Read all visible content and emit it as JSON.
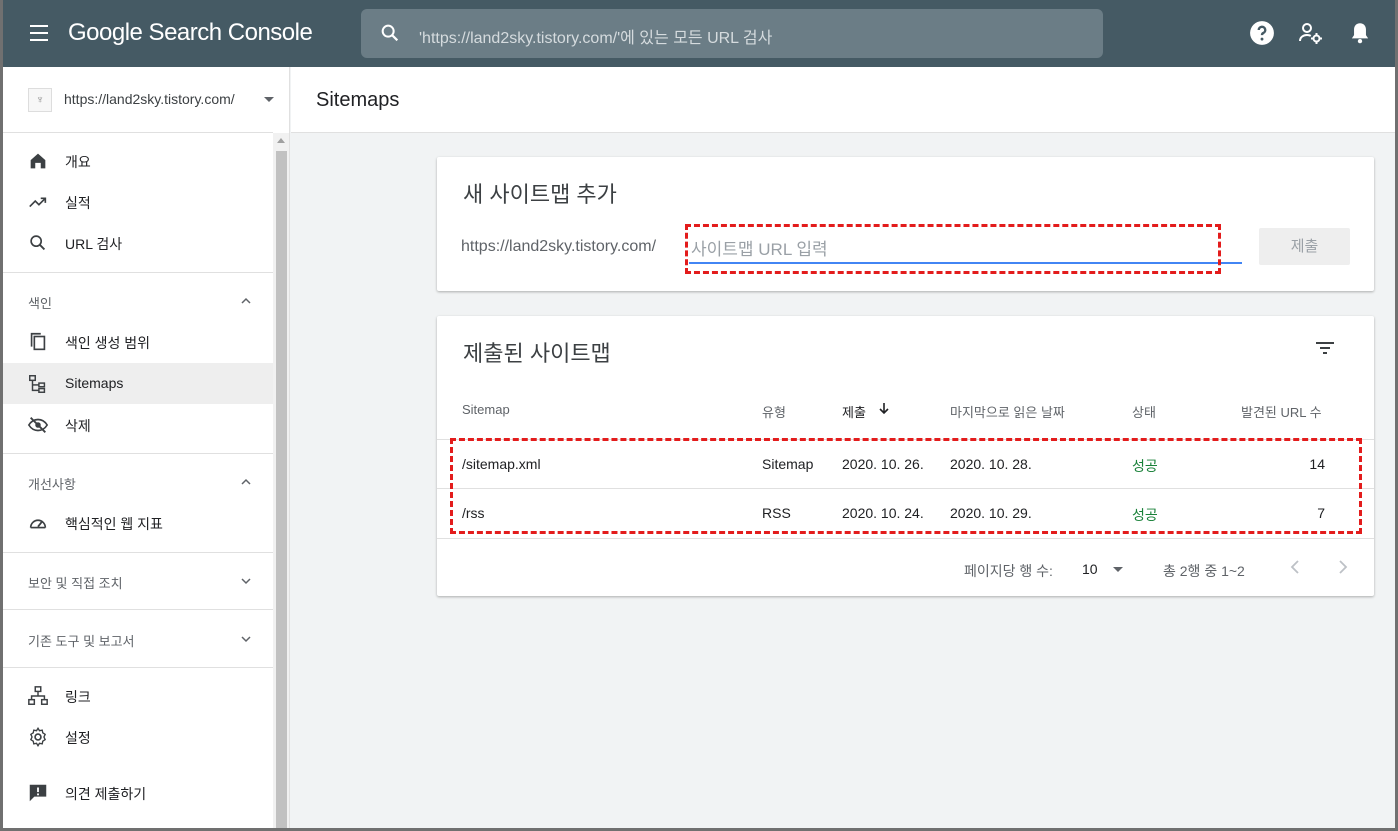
{
  "header": {
    "app_title": "Google Search Console",
    "search_placeholder": "'https://land2sky.tistory.com/'에 있는 모든 URL 검사"
  },
  "sidebar": {
    "property_url": "https://land2sky.tistory.com/",
    "items_top": [
      {
        "label": "개요",
        "icon": "home-icon"
      },
      {
        "label": "실적",
        "icon": "trending-up-icon"
      },
      {
        "label": "URL 검사",
        "icon": "search-icon"
      }
    ],
    "index_section": {
      "label": "색인",
      "items": [
        {
          "label": "색인 생성 범위",
          "icon": "copy-icon"
        },
        {
          "label": "Sitemaps",
          "icon": "sitemap-icon",
          "active": true
        },
        {
          "label": "삭제",
          "icon": "eye-off-icon"
        }
      ]
    },
    "enhancements_section": {
      "label": "개선사항",
      "items": [
        {
          "label": "핵심적인 웹 지표",
          "icon": "speedometer-icon"
        }
      ]
    },
    "security_section": {
      "label": "보안 및 직접 조치"
    },
    "legacy_section": {
      "label": "기존 도구 및 보고서"
    },
    "items_bottom": [
      {
        "label": "링크",
        "icon": "links-icon"
      },
      {
        "label": "설정",
        "icon": "gear-icon"
      }
    ],
    "feedback": {
      "label": "의견 제출하기",
      "icon": "feedback-icon"
    }
  },
  "page": {
    "title": "Sitemaps"
  },
  "add_card": {
    "title": "새 사이트맵 추가",
    "url_prefix": "https://land2sky.tistory.com/",
    "input_placeholder": "사이트맵 URL 입력",
    "input_value": "",
    "submit_label": "제출"
  },
  "submitted_card": {
    "title": "제출된 사이트맵",
    "columns": [
      "Sitemap",
      "유형",
      "제출",
      "마지막으로 읽은 날짜",
      "상태",
      "발견된 URL 수"
    ],
    "sorted_column": "제출",
    "rows": [
      {
        "sitemap": "/sitemap.xml",
        "type": "Sitemap",
        "submitted": "2020. 10. 26.",
        "last_read": "2020. 10. 28.",
        "status": "성공",
        "urls": "14"
      },
      {
        "sitemap": "/rss",
        "type": "RSS",
        "submitted": "2020. 10. 24.",
        "last_read": "2020. 10. 29.",
        "status": "성공",
        "urls": "7"
      }
    ],
    "pager": {
      "rows_per_page_label": "페이지당 행 수:",
      "rows_per_page": "10",
      "range": "총 2행 중 1~2"
    }
  },
  "colors": {
    "topbar": "#455a64",
    "accent": "#4285f4",
    "success": "#188038",
    "highlight": "#e31c1c"
  }
}
